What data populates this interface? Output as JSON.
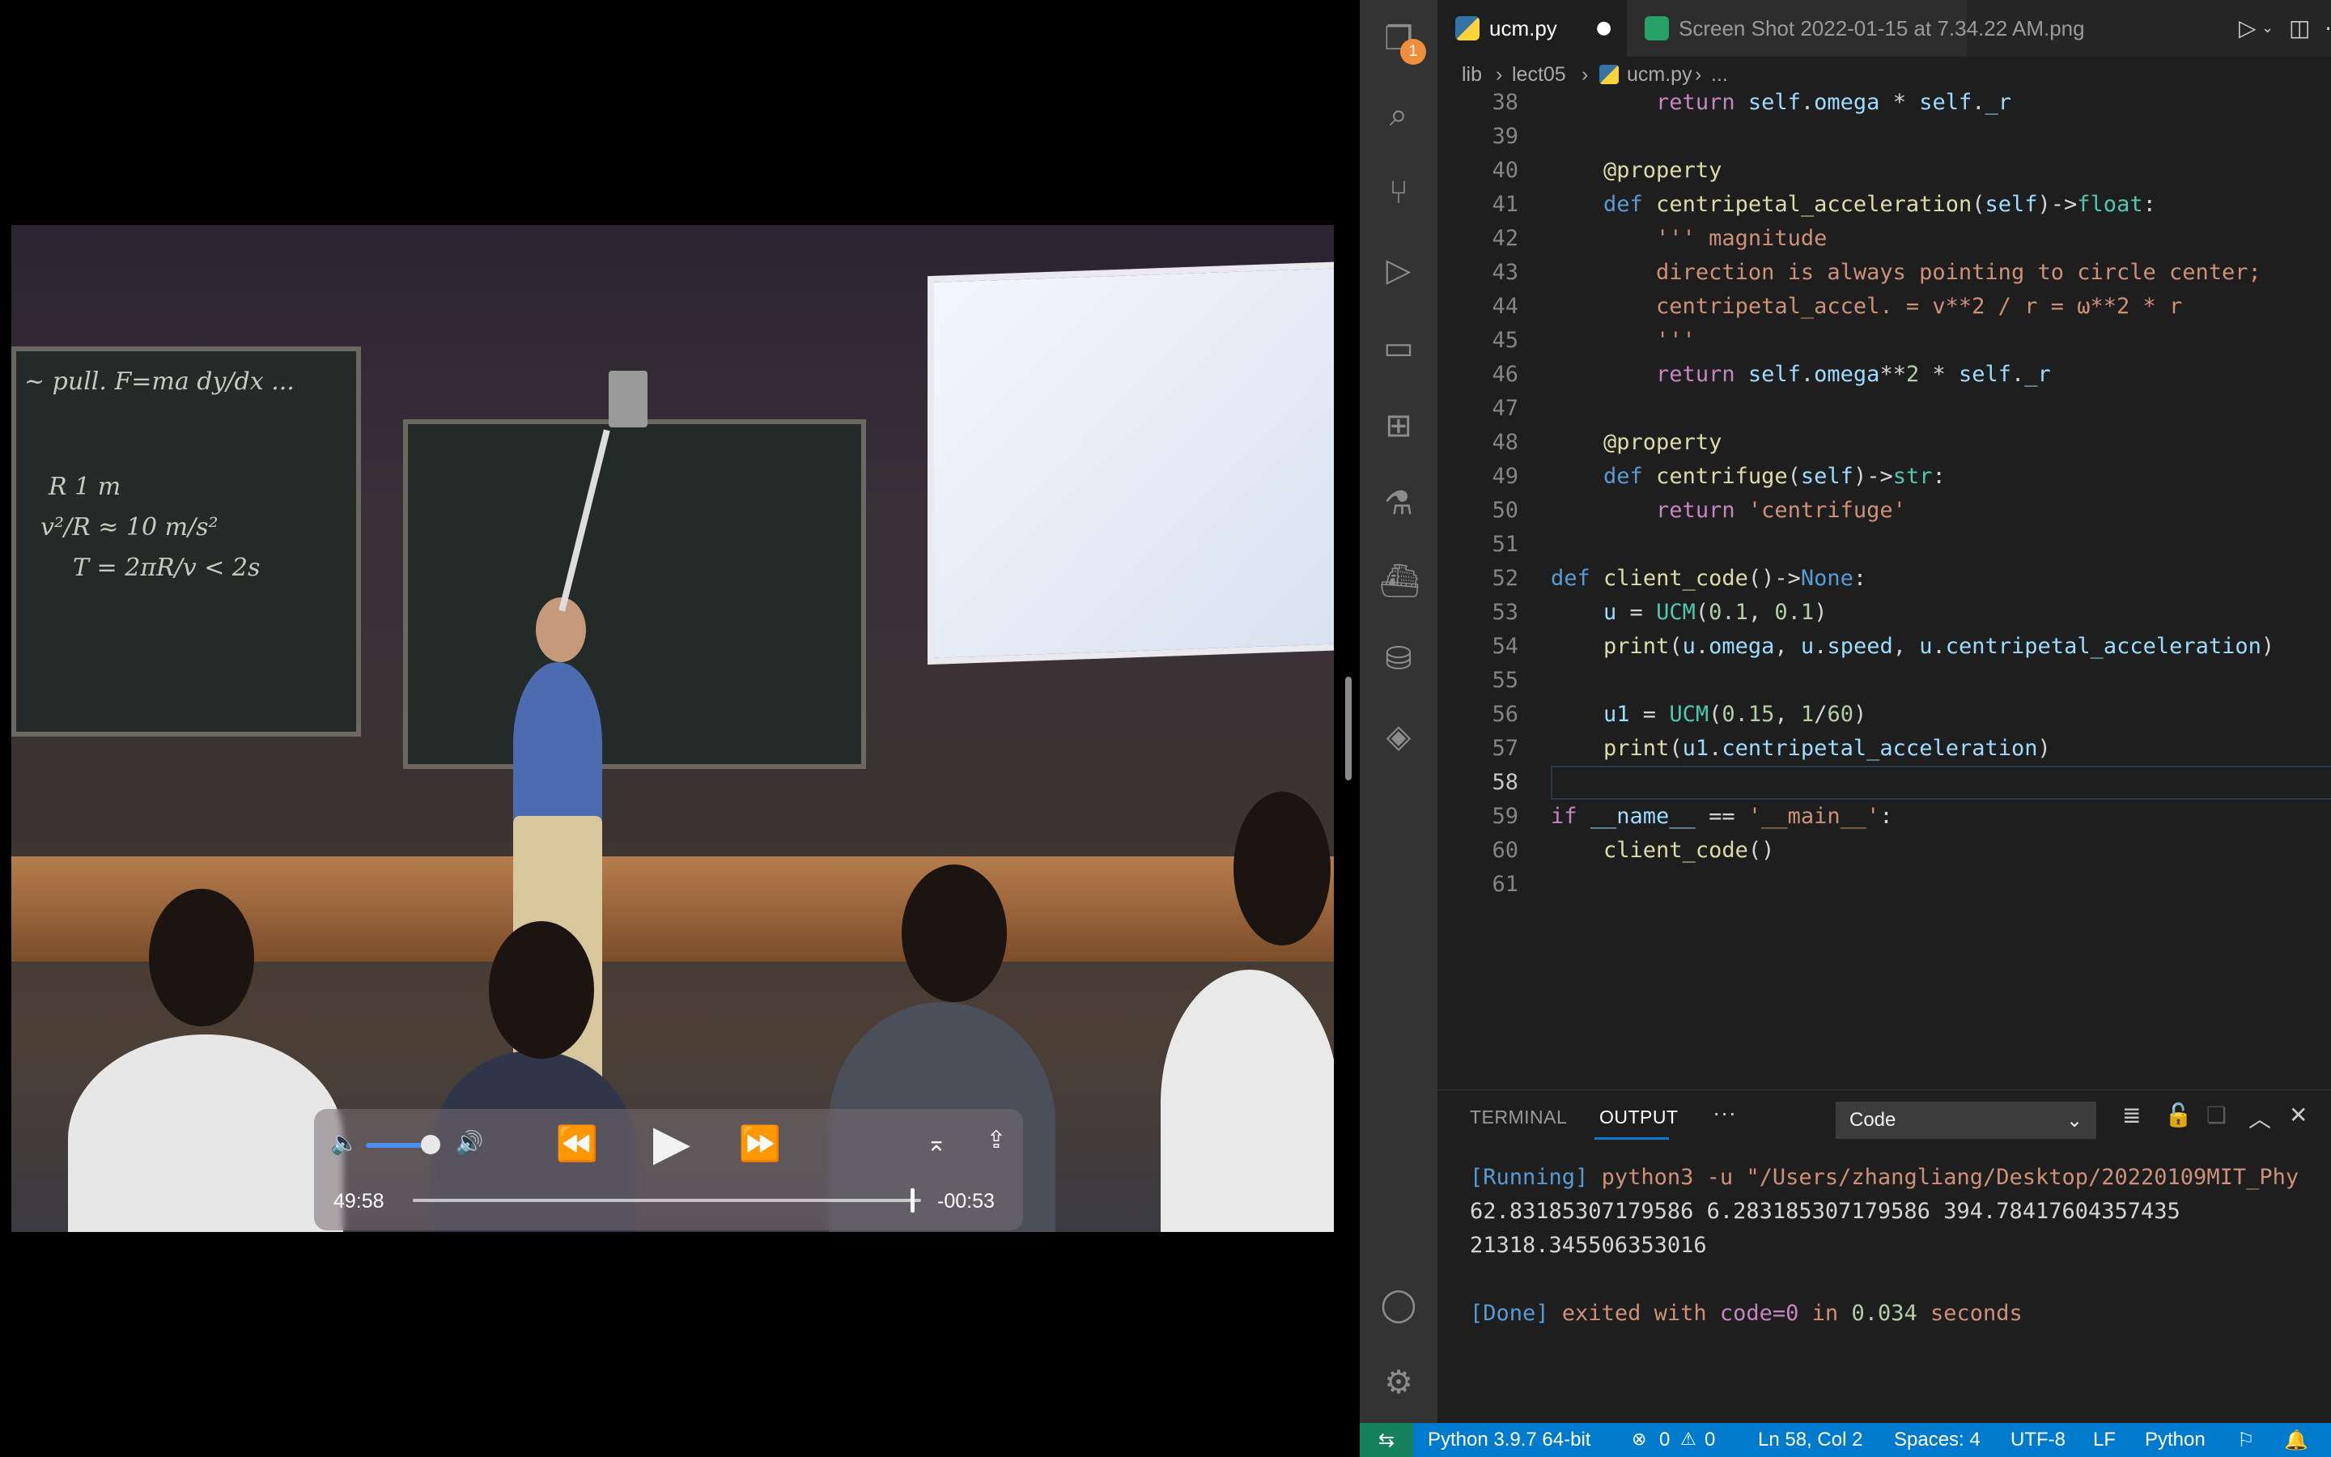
{
  "player": {
    "time_elapsed": "49:58",
    "time_remaining": "-00:53",
    "volume_level": 0.8,
    "progress_fraction": 0.98,
    "icons": {
      "volume_low": "volume-low-icon",
      "volume_high": "volume-high-icon",
      "rewind": "rewind-icon",
      "play": "play-icon",
      "fast_forward": "fast-forward-icon",
      "airplay": "airplay-icon",
      "share": "share-icon"
    }
  },
  "activity_bar": {
    "explorer_badge": "1",
    "items": [
      "files-icon",
      "search-icon",
      "source-control-icon",
      "run-debug-icon",
      "remote-explorer-icon",
      "extensions-icon",
      "testing-icon",
      "docker-icon",
      "database-icon",
      "stack-icon"
    ],
    "bottom": [
      "account-icon",
      "settings-gear-icon"
    ]
  },
  "tabs": [
    {
      "label": "ucm.py",
      "active": true,
      "dirty": true
    },
    {
      "label": "Screen Shot 2022-01-15 at 7.34.22 AM.png",
      "active": false
    }
  ],
  "breadcrumb": [
    "lib",
    "lect05",
    "ucm.py",
    "..."
  ],
  "editor": {
    "current_line": 58,
    "lines": [
      {
        "n": "38",
        "html": "        <span class='cf'>return</span> <span class='var'>self</span>.<span class='var'>omega</span> * <span class='var'>self</span>.<span class='var'>_r</span>"
      },
      {
        "n": "39",
        "html": ""
      },
      {
        "n": "40",
        "html": "    <span class='dec'>@property</span>"
      },
      {
        "n": "41",
        "html": "    <span class='kw'>def</span> <span class='fn'>centripetal_acceleration</span>(<span class='var'>self</span>)-><span class='ty'>float</span>:"
      },
      {
        "n": "42",
        "html": "        <span class='st'>''' magnitude</span>"
      },
      {
        "n": "43",
        "html": "        <span class='st'>direction is always pointing to circle center;</span>"
      },
      {
        "n": "44",
        "html": "        <span class='st'>centripetal_accel. = v**2 / r = ω**2 * r</span>"
      },
      {
        "n": "45",
        "html": "        <span class='st'>'''</span>"
      },
      {
        "n": "46",
        "html": "        <span class='cf'>return</span> <span class='var'>self</span>.<span class='var'>omega</span>**<span class='num'>2</span> * <span class='var'>self</span>.<span class='var'>_r</span>"
      },
      {
        "n": "47",
        "html": ""
      },
      {
        "n": "48",
        "html": "    <span class='dec'>@property</span>"
      },
      {
        "n": "49",
        "html": "    <span class='kw'>def</span> <span class='fn'>centrifuge</span>(<span class='var'>self</span>)-><span class='ty'>str</span>:"
      },
      {
        "n": "50",
        "html": "        <span class='cf'>return</span> <span class='st'>'centrifuge'</span>"
      },
      {
        "n": "51",
        "html": ""
      },
      {
        "n": "52",
        "html": "<span class='kw'>def</span> <span class='fn'>client_code</span>()-><span class='kw'>None</span>:"
      },
      {
        "n": "53",
        "html": "    <span class='var'>u</span> = <span class='ty'>UCM</span>(<span class='num'>0.1</span>, <span class='num'>0.1</span>)"
      },
      {
        "n": "54",
        "html": "    <span class='fn'>print</span>(<span class='var'>u</span>.<span class='var'>omega</span>, <span class='var'>u</span>.<span class='var'>speed</span>, <span class='var'>u</span>.<span class='var'>centripetal_acceleration</span>)"
      },
      {
        "n": "55",
        "html": ""
      },
      {
        "n": "56",
        "html": "    <span class='var'>u1</span> = <span class='ty'>UCM</span>(<span class='num'>0.15</span>, <span class='num'>1</span>/<span class='num'>60</span>)"
      },
      {
        "n": "57",
        "html": "    <span class='fn'>print</span>(<span class='var'>u1</span>.<span class='var'>centripetal_acceleration</span>)"
      },
      {
        "n": "58",
        "html": ""
      },
      {
        "n": "59",
        "html": "<span class='cf'>if</span> <span class='var'>__name__</span> == <span class='st'>'__main__'</span>:"
      },
      {
        "n": "60",
        "html": "    <span class='fn'>client_code</span>()"
      },
      {
        "n": "61",
        "html": ""
      }
    ]
  },
  "panel": {
    "tabs": [
      "TERMINAL",
      "OUTPUT"
    ],
    "active_tab": "OUTPUT",
    "more": "···",
    "channel": "Code",
    "output": {
      "running_tag": "[Running]",
      "running_cmd": " python3 -u \"/Users/zhangliang/Desktop/20220109MIT_Phy",
      "line1": "62.83185307179586 6.283185307179586 394.78417604357435",
      "line2": "21318.345506353016",
      "done_tag": "[Done]",
      "done_text": " exited with ",
      "done_code": "code=0",
      "done_in": " in ",
      "done_time": "0.034",
      "done_seconds": " seconds"
    }
  },
  "statusbar": {
    "interpreter": "Python 3.9.7 64-bit",
    "errors": "0",
    "warnings": "0",
    "position": "Ln 58, Col 2",
    "spaces": "Spaces: 4",
    "encoding": "UTF-8",
    "eol": "LF",
    "language": "Python"
  },
  "colors": {
    "statusbar": "#007acc",
    "remote": "#16825d",
    "badge": "#f18e3c",
    "volume_accent": "#4d8ef0"
  }
}
